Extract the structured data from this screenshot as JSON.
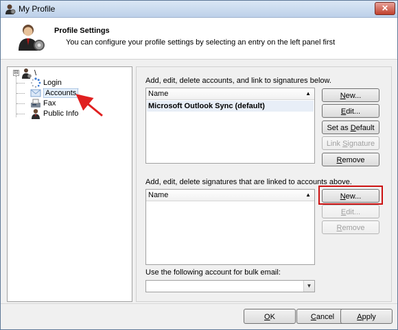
{
  "window": {
    "title": "My Profile",
    "close_glyph": "✕"
  },
  "header": {
    "title": "Profile Settings",
    "description": "You can configure your profile settings by selecting an entry on the left panel first",
    "icon": "user-profile-settings-icon"
  },
  "tree": {
    "root_label": "\\",
    "expander": "⊟",
    "items": [
      {
        "label": "Login",
        "icon": "login-spinner-icon"
      },
      {
        "label": "Accounts",
        "icon": "accounts-mail-icon",
        "selected": true
      },
      {
        "label": "Fax",
        "icon": "fax-machine-icon"
      },
      {
        "label": "Public Info",
        "icon": "person-icon"
      }
    ]
  },
  "accounts": {
    "label": "Add, edit, delete accounts, and link to signatures below.",
    "column": "Name",
    "rows": [
      "Microsoft Outlook Sync (default)"
    ],
    "buttons": {
      "new": {
        "pre": "",
        "u": "N",
        "post": "ew..."
      },
      "edit": {
        "pre": "",
        "u": "E",
        "post": "dit..."
      },
      "set_default": {
        "pre": "Set as ",
        "u": "D",
        "post": "efault"
      },
      "link_signature": {
        "pre": "Link ",
        "u": "S",
        "post": "ignature"
      },
      "remove": {
        "pre": "",
        "u": "R",
        "post": "emove"
      }
    }
  },
  "signatures": {
    "label": "Add, edit, delete signatures that are linked to accounts above.",
    "column": "Name",
    "buttons": {
      "new": {
        "pre": "",
        "u": "N",
        "post": "ew..."
      },
      "edit": {
        "pre": "",
        "u": "E",
        "post": "dit..."
      },
      "remove": {
        "pre": "",
        "u": "R",
        "post": "emove"
      }
    }
  },
  "bulk": {
    "label": "Use the following account for bulk email:",
    "value": ""
  },
  "footer": {
    "ok": {
      "pre": "",
      "u": "O",
      "post": "K"
    },
    "cancel": {
      "pre": "",
      "u": "C",
      "post": "ancel"
    },
    "apply": {
      "pre": "",
      "u": "A",
      "post": "pply"
    }
  },
  "annotation": {
    "arrow_color": "#e02020",
    "highlight_color": "#cc1111"
  }
}
